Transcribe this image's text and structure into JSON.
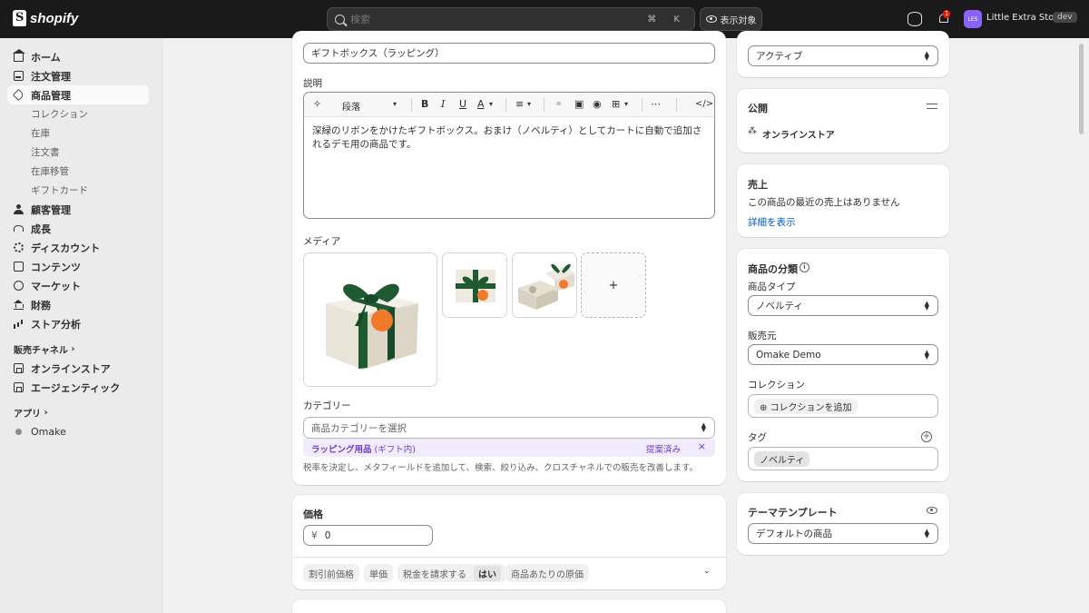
{
  "topbar": {
    "logo_text": "shopify",
    "search_placeholder": "検索",
    "search_shortcut": "⌘ K",
    "view_button": "表示対象",
    "notification_count": "1",
    "avatar_initials": "LES",
    "store_name": "Little Extra Store",
    "env_badge": "dev"
  },
  "sidebar": {
    "items": [
      {
        "label": "ホーム",
        "icon": "home-icon"
      },
      {
        "label": "注文管理",
        "icon": "inbox-icon"
      },
      {
        "label": "商品管理",
        "icon": "tag-icon",
        "active": true
      },
      {
        "label": "顧客管理",
        "icon": "person-icon"
      },
      {
        "label": "成長",
        "icon": "gauge-icon"
      },
      {
        "label": "ディスカウント",
        "icon": "discount-icon"
      },
      {
        "label": "コンテンツ",
        "icon": "content-icon"
      },
      {
        "label": "マーケット",
        "icon": "globe-icon"
      },
      {
        "label": "財務",
        "icon": "bank-icon"
      },
      {
        "label": "ストア分析",
        "icon": "chart-bars-icon"
      }
    ],
    "sub_items": [
      "コレクション",
      "在庫",
      "注文書",
      "在庫移管",
      "ギフトカード"
    ],
    "sales_channels_label": "販売チャネル",
    "channels": [
      "オンラインストア",
      "エージェンティック"
    ],
    "apps_label": "アプリ",
    "apps": [
      "Omake"
    ]
  },
  "product": {
    "title_value": "ギフトボックス（ラッピング）",
    "description_label": "説明",
    "toolbar_paragraph": "段落",
    "description_text": "深緑のリボンをかけたギフトボックス。おまけ（ノベルティ）としてカートに自動で追加されるデモ用の商品です。",
    "media_label": "メディア",
    "media_add": "+",
    "category_label": "カテゴリー",
    "category_placeholder": "商品カテゴリーを選択",
    "suggestion_bold": "ラッピング用品",
    "suggestion_rest": " (ギフト内)",
    "suggestion_status": "提案済み",
    "suggestion_dismiss": "×",
    "category_help": "税率を決定し、メタフィールドを追加して、検索、絞り込み、クロスチャネルでの販売を改善します。"
  },
  "pricing": {
    "title": "価格",
    "currency": "¥",
    "price_value": "0",
    "pills": [
      "割引前価格",
      "単価",
      "税金を請求する",
      "商品あたりの原価"
    ],
    "tax_value": "はい"
  },
  "right": {
    "status_value": "アクティブ",
    "publishing_title": "公開",
    "publishing_channel": "オンラインストア",
    "sales_title": "売上",
    "sales_empty": "この商品の最近の売上はありません",
    "sales_link": "詳細を表示",
    "org_title": "商品の分類",
    "type_label": "商品タイプ",
    "type_value": "ノベルティ",
    "vendor_label": "販売元",
    "vendor_value": "Omake Demo",
    "collection_label": "コレクション",
    "collection_add": "コレクションを追加",
    "tags_label": "タグ",
    "tag_value": "ノベルティ",
    "theme_title": "テーマテンプレート",
    "theme_value": "デフォルトの商品"
  },
  "colors": {
    "topbar_bg": "#1a1a1a",
    "accent_purple": "#6f3bd0",
    "link_blue": "#005bd3",
    "ribbon_green": "#1f5a32",
    "tag_orange": "#f07a2a"
  }
}
